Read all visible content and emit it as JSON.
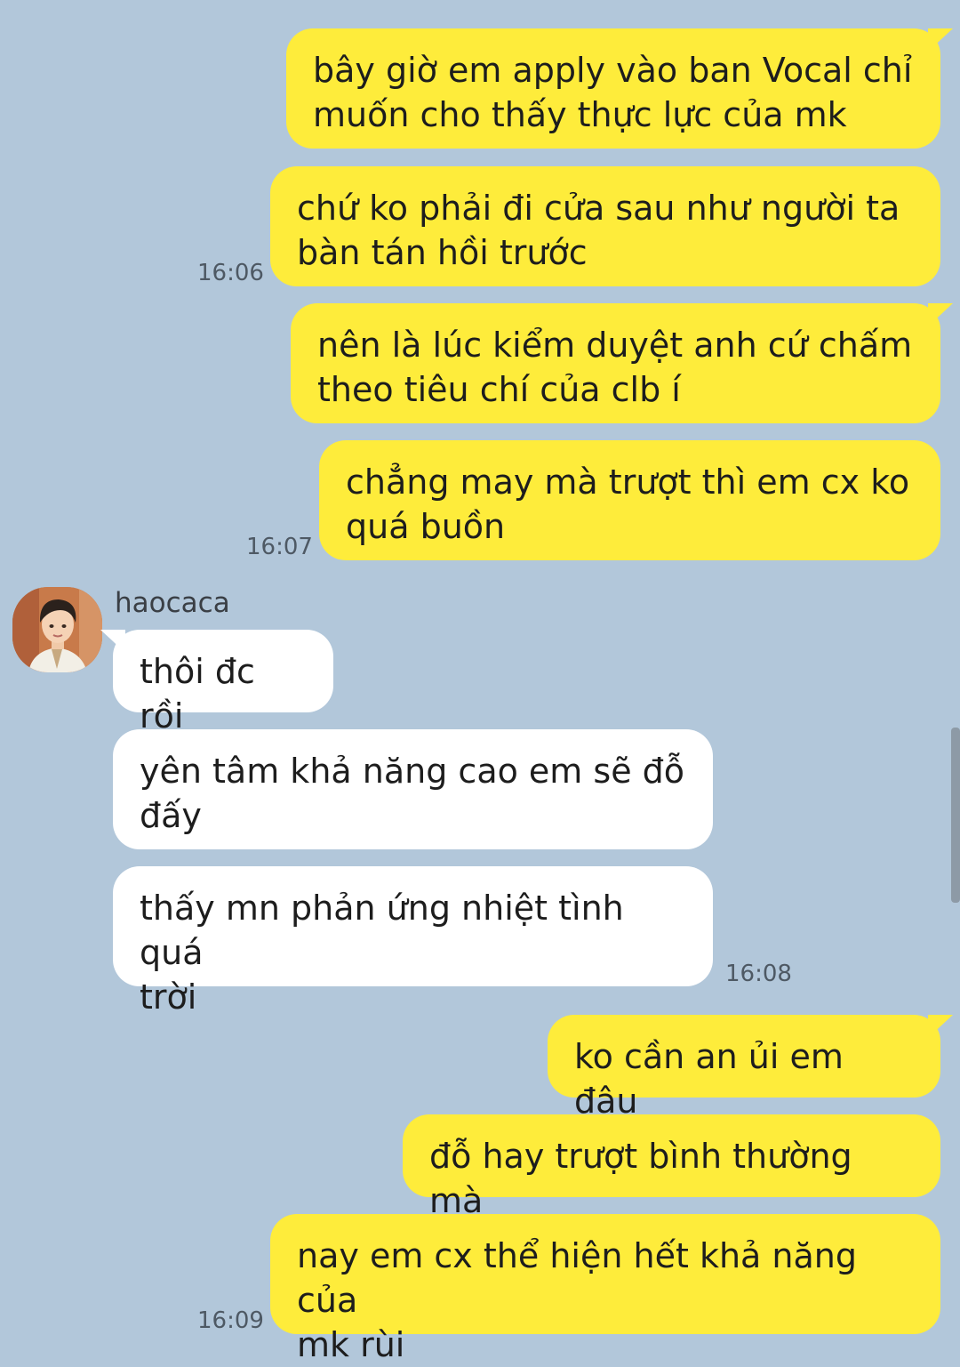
{
  "conversation": {
    "sender_name": "haocaca",
    "messages": [
      {
        "direction": "out",
        "text": "bây giờ em apply vào ban Vocal chỉ\nmuốn cho thấy thực lực của mk"
      },
      {
        "direction": "out",
        "text": "chứ ko phải đi cửa sau như người ta\nbàn tán hồi trước",
        "time": "16:06"
      },
      {
        "direction": "out",
        "text": "nên là lúc kiểm duyệt anh cứ chấm\ntheo tiêu chí của clb í"
      },
      {
        "direction": "out",
        "text": "chẳng may mà trượt thì em cx ko\nquá buồn",
        "time": "16:07"
      },
      {
        "direction": "in",
        "text": "thôi đc rồi"
      },
      {
        "direction": "in",
        "text": "yên tâm khả năng cao em sẽ đỗ\nđấy"
      },
      {
        "direction": "in",
        "text": "thấy mn phản ứng nhiệt tình quá\ntrời",
        "time": "16:08"
      },
      {
        "direction": "out",
        "text": "ko cần an ủi em đâu"
      },
      {
        "direction": "out",
        "text": "đỗ hay trượt bình thường mà"
      },
      {
        "direction": "out",
        "text": "nay em cx thể hiện hết khả năng của\nmk rùi",
        "time": "16:09"
      }
    ]
  },
  "colors": {
    "background": "#b2c7da",
    "outgoing_bubble": "#feec3b",
    "incoming_bubble": "#ffffff"
  },
  "icons": {
    "avatar": "user-photo-avatar"
  }
}
